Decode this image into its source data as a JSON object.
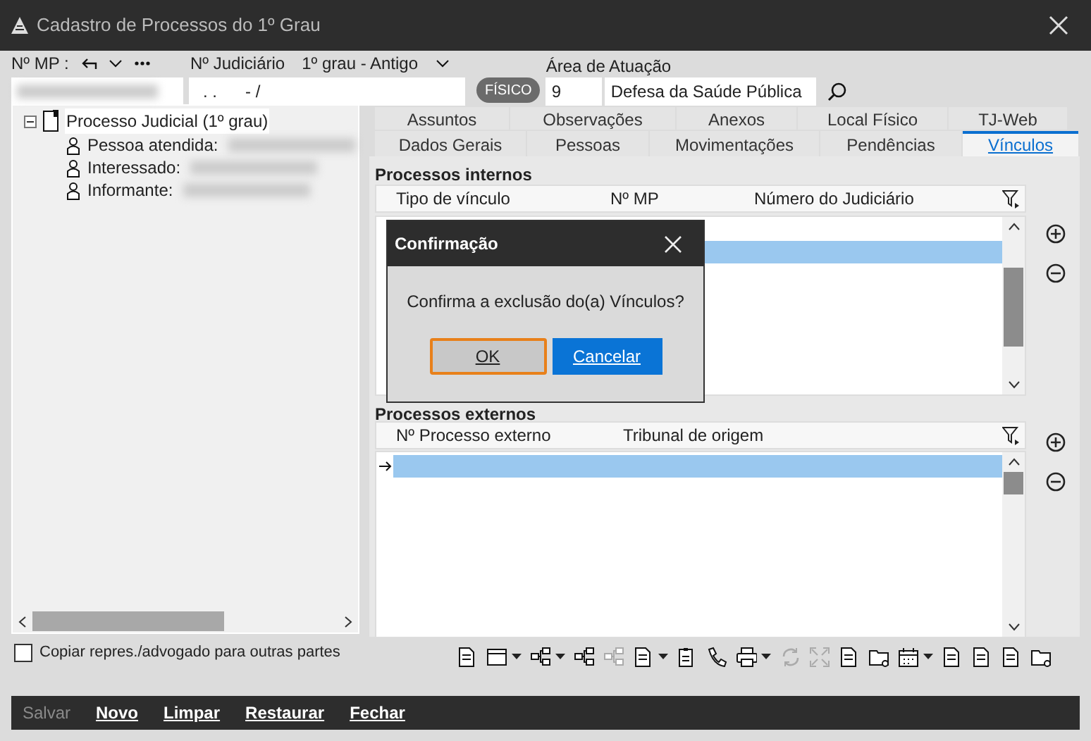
{
  "window": {
    "title": "Cadastro de Processos do 1º Grau"
  },
  "header": {
    "mp_label": "Nº MP :",
    "judiciario_label": "Nº Judiciário",
    "grau": "1º grau - Antigo",
    "judiciario_value": ". .      - /",
    "badge": "FÍSICO",
    "area_label": "Área de Atuação",
    "area_code": "9",
    "area_name": "Defesa da Saúde Pública"
  },
  "tree": {
    "label": "Processo Judicial (1º grau)",
    "selected": true,
    "expanded": true,
    "children": [
      {
        "label": "Pessoa atendida:",
        "selected": false
      },
      {
        "label": "Interessado:",
        "selected": false
      },
      {
        "label": "Informante:",
        "selected": false
      }
    ]
  },
  "copy_checkbox": {
    "label": "Copiar repres./advogado para outras partes",
    "checked": false
  },
  "tabs_top": [
    {
      "label": "Assuntos",
      "selected": false
    },
    {
      "label": "Observações",
      "selected": false
    },
    {
      "label": "Anexos",
      "selected": false
    },
    {
      "label": "Local Físico",
      "selected": false
    },
    {
      "label": "TJ-Web",
      "selected": false
    }
  ],
  "tabs_bottom": [
    {
      "label": "Dados Gerais",
      "selected": false
    },
    {
      "label": "Pessoas",
      "selected": false
    },
    {
      "label": "Movimentações",
      "selected": false
    },
    {
      "label": "Pendências",
      "selected": false
    },
    {
      "label": "Vínculos",
      "selected": true
    }
  ],
  "internos": {
    "title": "Processos internos",
    "columns": [
      "Tipo de vínculo",
      "Nº MP",
      "Número do Judiciário"
    ]
  },
  "externos": {
    "title": "Processos externos",
    "columns": [
      "Nº Processo externo",
      "Tribunal de origem"
    ]
  },
  "dialog": {
    "title": "Confirmação",
    "message": "Confirma a exclusão do(a) Vínculos?",
    "buttons": [
      {
        "label": "OK",
        "focused": true
      },
      {
        "label": "Cancelar",
        "focused": false
      }
    ]
  },
  "toolbar": [
    {
      "kind": "document",
      "disabled": false,
      "menu": false
    },
    {
      "kind": "window",
      "disabled": false,
      "menu": true
    },
    {
      "kind": "tree",
      "disabled": false,
      "menu": true
    },
    {
      "kind": "tree",
      "disabled": false,
      "menu": false
    },
    {
      "kind": "tree",
      "disabled": true,
      "menu": false
    },
    {
      "kind": "document",
      "disabled": false,
      "menu": true
    },
    {
      "kind": "clipboard",
      "disabled": false,
      "menu": false
    },
    {
      "kind": "phone",
      "disabled": false,
      "menu": false
    },
    {
      "kind": "printer",
      "disabled": false,
      "menu": true
    },
    {
      "kind": "refresh",
      "disabled": true,
      "menu": false
    },
    {
      "kind": "expand",
      "disabled": true,
      "menu": false
    },
    {
      "kind": "document",
      "disabled": false,
      "menu": false
    },
    {
      "kind": "folder",
      "disabled": false,
      "menu": false
    },
    {
      "kind": "calendar",
      "disabled": false,
      "menu": true
    },
    {
      "kind": "document",
      "disabled": false,
      "menu": false
    },
    {
      "kind": "document",
      "disabled": false,
      "menu": false
    },
    {
      "kind": "document",
      "disabled": false,
      "menu": false
    },
    {
      "kind": "folder",
      "disabled": false,
      "menu": false
    }
  ],
  "actions": [
    {
      "label": "Salvar",
      "disabled": true
    },
    {
      "label": "Novo",
      "disabled": false
    },
    {
      "label": "Limpar",
      "disabled": false
    },
    {
      "label": "Restaurar",
      "disabled": false
    },
    {
      "label": "Fechar",
      "disabled": false
    }
  ]
}
